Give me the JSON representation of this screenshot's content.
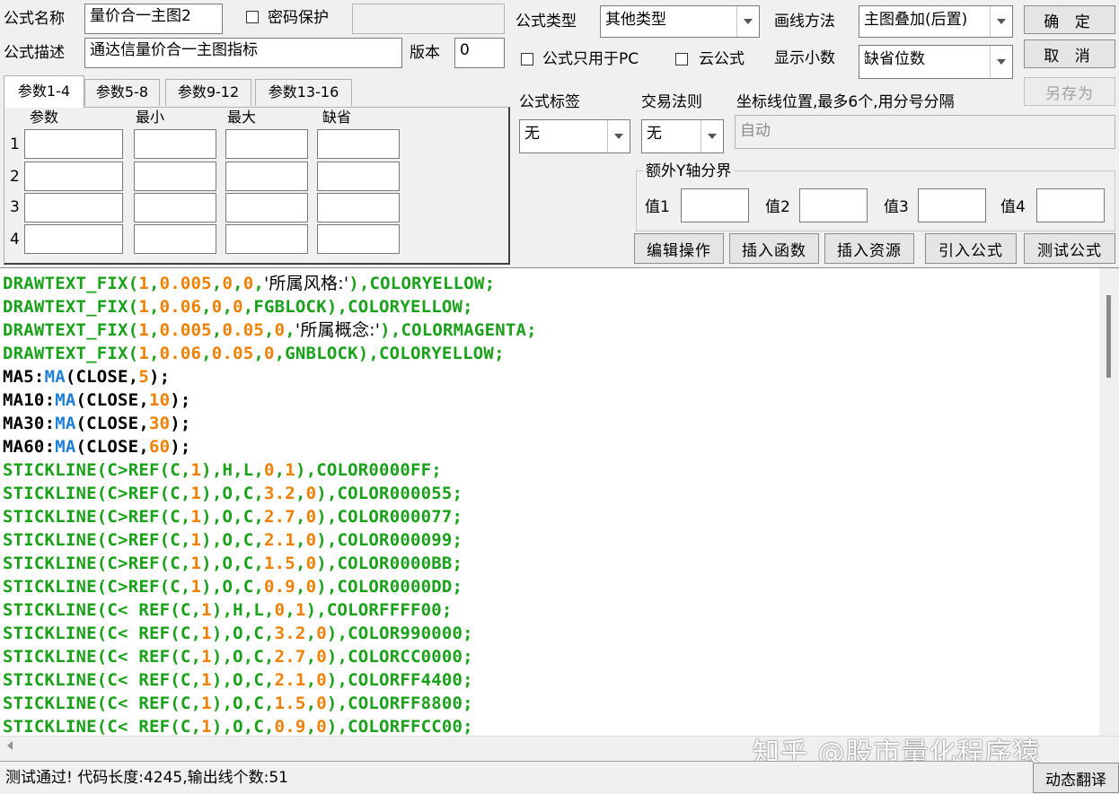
{
  "form": {
    "name_label": "公式名称",
    "name_value": "量价合一主图2",
    "password_label": "密码保护",
    "desc_label": "公式描述",
    "desc_value": "通达信量价合一主图指标",
    "version_label": "版本",
    "version_value": "0",
    "type_label": "公式类型",
    "type_value": "其他类型",
    "draw_method_label": "画线方法",
    "draw_method_value": "主图叠加(后置)",
    "pc_only_label": "公式只用于PC",
    "cloud_label": "云公式",
    "decimals_label": "显示小数",
    "decimals_value": "缺省位数",
    "tag_label": "公式标签",
    "tag_value": "无",
    "trade_rule_label": "交易法则",
    "trade_rule_value": "无",
    "axis_label": "坐标线位置,最多6个,用分号分隔",
    "axis_value": "自动",
    "y_axis_group_label": "额外Y轴分界",
    "y_values": [
      "值1",
      "值2",
      "值3",
      "值4"
    ]
  },
  "buttons": {
    "ok": "确 定",
    "cancel": "取 消",
    "save_as": "另存为",
    "edit_ops": "编辑操作",
    "insert_func": "插入函数",
    "insert_res": "插入资源",
    "import_formula": "引入公式",
    "test_formula": "测试公式",
    "translate": "动态翻译"
  },
  "tabs": [
    "参数1-4",
    "参数5-8",
    "参数9-12",
    "参数13-16"
  ],
  "param_headers": [
    "参数",
    "最小",
    "最大",
    "缺省"
  ],
  "param_rows": [
    "1",
    "2",
    "3",
    "4"
  ],
  "code_lines": [
    "DRAWTEXT_FIX(1,0.005,0,0,'所属风格:'),COLORYELLOW;",
    "DRAWTEXT_FIX(1,0.06,0,0,FGBLOCK),COLORYELLOW;",
    "DRAWTEXT_FIX(1,0.005,0.05,0,'所属概念:'),COLORMAGENTA;",
    "DRAWTEXT_FIX(1,0.06,0.05,0,GNBLOCK),COLORYELLOW;",
    "MA5:MA(CLOSE,5);",
    "MA10:MA(CLOSE,10);",
    "MA30:MA(CLOSE,30);",
    "MA60:MA(CLOSE,60);",
    "STICKLINE(C>REF(C,1),H,L,0,1),COLOR0000FF;",
    "STICKLINE(C>REF(C,1),O,C,3.2,0),COLOR000055;",
    "STICKLINE(C>REF(C,1),O,C,2.7,0),COLOR000077;",
    "STICKLINE(C>REF(C,1),O,C,2.1,0),COLOR000099;",
    "STICKLINE(C>REF(C,1),O,C,1.5,0),COLOR0000BB;",
    "STICKLINE(C>REF(C,1),O,C,0.9,0),COLOR0000DD;",
    "STICKLINE(C< REF(C,1),H,L,0,1),COLORFFFF00;",
    "STICKLINE(C< REF(C,1),O,C,3.2,0),COLOR990000;",
    "STICKLINE(C< REF(C,1),O,C,2.7,0),COLORCC0000;",
    "STICKLINE(C< REF(C,1),O,C,2.1,0),COLORFF4400;",
    "STICKLINE(C< REF(C,1),O,C,1.5,0),COLORFF8800;",
    "STICKLINE(C< REF(C,1),O,C,0.9,0),COLORFFCC00;"
  ],
  "status_text": "测试通过! 代码长度:4245,输出线个数:51",
  "watermark": "知乎 @股市量化程序猿",
  "colors": {
    "keyword": "#1aa11a",
    "number": "#f08000",
    "function": "#1e7fd8",
    "variable": "#000000"
  }
}
